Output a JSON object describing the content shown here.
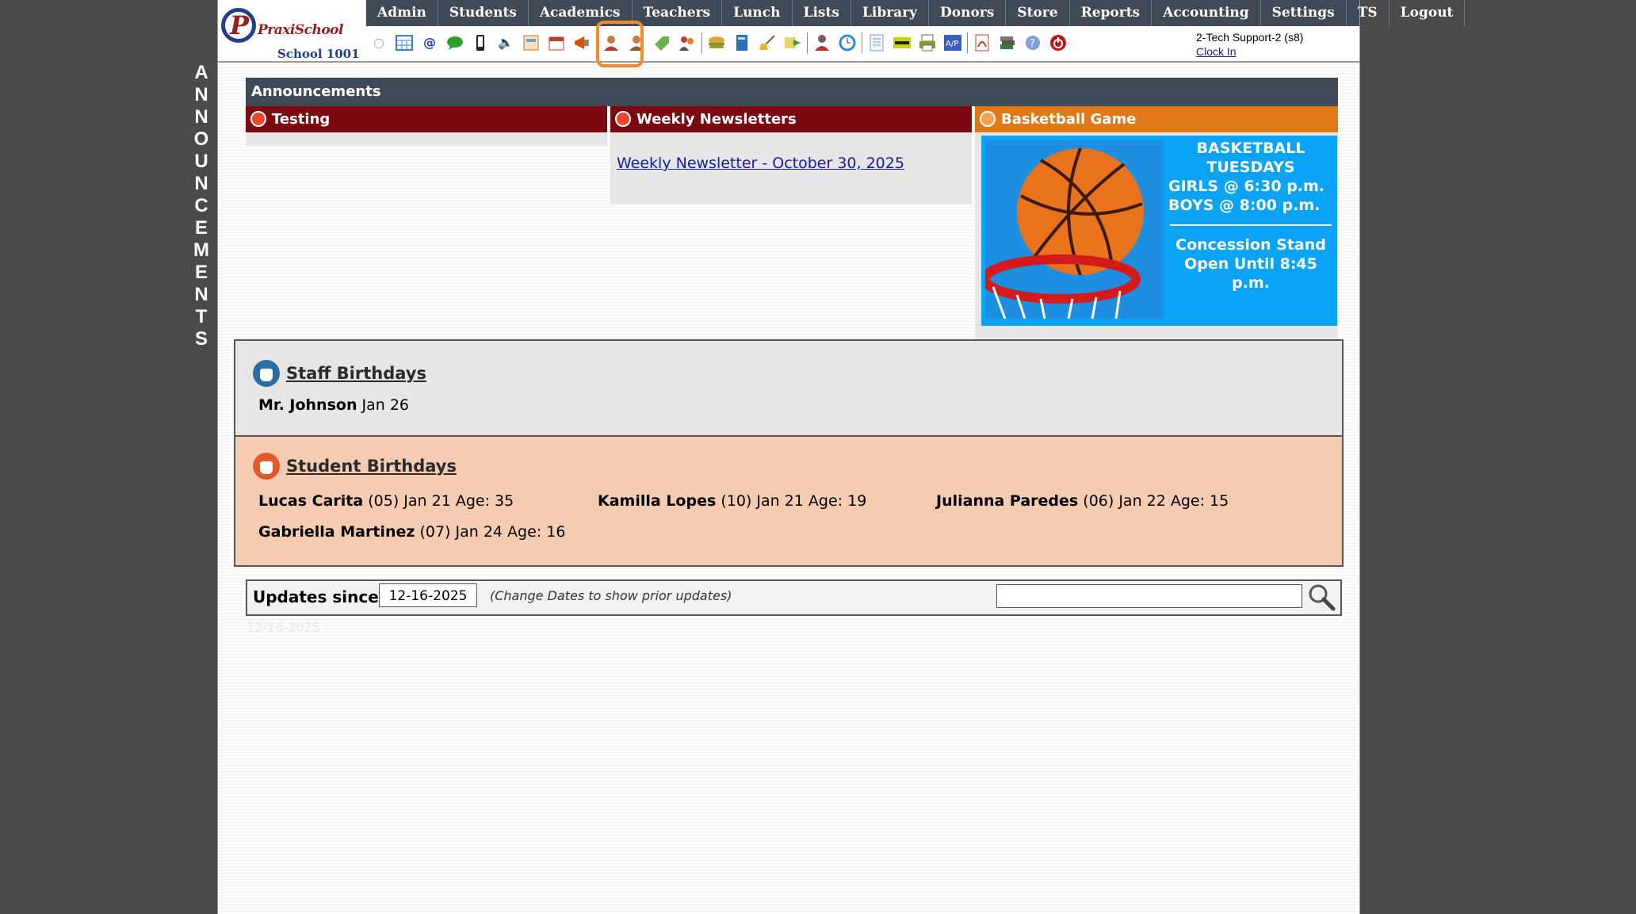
{
  "side_label": [
    "A",
    "N",
    "N",
    "O",
    "U",
    "N",
    "C",
    "E",
    "M",
    "E",
    "N",
    "T",
    "S"
  ],
  "logo": {
    "brand": "PraxiSchool",
    "school": "School 1001"
  },
  "nav": [
    "Admin",
    "Students",
    "Academics",
    "Teachers",
    "Lunch",
    "Lists",
    "Library",
    "Donors",
    "Store",
    "Reports",
    "Accounting",
    "Settings",
    "TS",
    "Logout"
  ],
  "toolbar_icons": [
    "search-icon",
    "grid-icon",
    "email-icon",
    "chat-icon",
    "phone-icon",
    "speaker-icon",
    "calendar-view-icon",
    "calendar-icon",
    "megaphone-icon",
    "student-add-icon",
    "student-icon",
    "tag-icon",
    "family-icon",
    "lunch-icon",
    "book-icon",
    "broom-icon",
    "transfer-icon",
    "staff-icon",
    "clock-icon",
    "document-icon",
    "barcode-icon",
    "printer-icon",
    "ap-icon",
    "pdf-icon",
    "stack-icon",
    "help-icon",
    "power-icon"
  ],
  "user": {
    "name": "2-Tech Support-2 (s8)",
    "clock_in": "Clock In"
  },
  "announcements": {
    "title": "Announcements",
    "testing": {
      "title": "Testing"
    },
    "newsletters": {
      "title": "Weekly Newsletters",
      "link": "Weekly Newsletter - October 30, 2025"
    },
    "basketball": {
      "title": "Basketball Game",
      "line1": "BASKETBALL",
      "line2": "TUESDAYS",
      "line3": "GIRLS @ 6:30 p.m.",
      "line4": "BOYS  @ 8:00 p.m.",
      "line5": "Concession Stand",
      "line6": "Open Until 8:45 p.m."
    }
  },
  "staff_birthdays": {
    "title": "Staff Birthdays",
    "entries": [
      {
        "name": "Mr. Johnson",
        "detail": "Jan 26"
      }
    ]
  },
  "student_birthdays": {
    "title": "Student Birthdays",
    "entries": [
      {
        "name": "Lucas Carita",
        "detail": "(05) Jan 21 Age: 35"
      },
      {
        "name": "Kamilla Lopes",
        "detail": "(10) Jan 21 Age: 19"
      },
      {
        "name": "Julianna Paredes",
        "detail": "(06) Jan 22 Age: 15"
      },
      {
        "name": "Gabriella Martinez",
        "detail": "(07) Jan 24 Age: 16"
      }
    ]
  },
  "updates": {
    "label": "Updates since:",
    "date": "12-16-2025",
    "hint": "(Change Dates to show prior updates)",
    "search_value": "",
    "faint_date": "12-16-2025"
  },
  "colors": {
    "nav_bg": "#3f4a56",
    "maroon": "#7a0a0f",
    "orange": "#e07818",
    "highlight": "#f28c28",
    "card_blue": "#0aa3f5",
    "student_bg": "#f5cbb2"
  }
}
